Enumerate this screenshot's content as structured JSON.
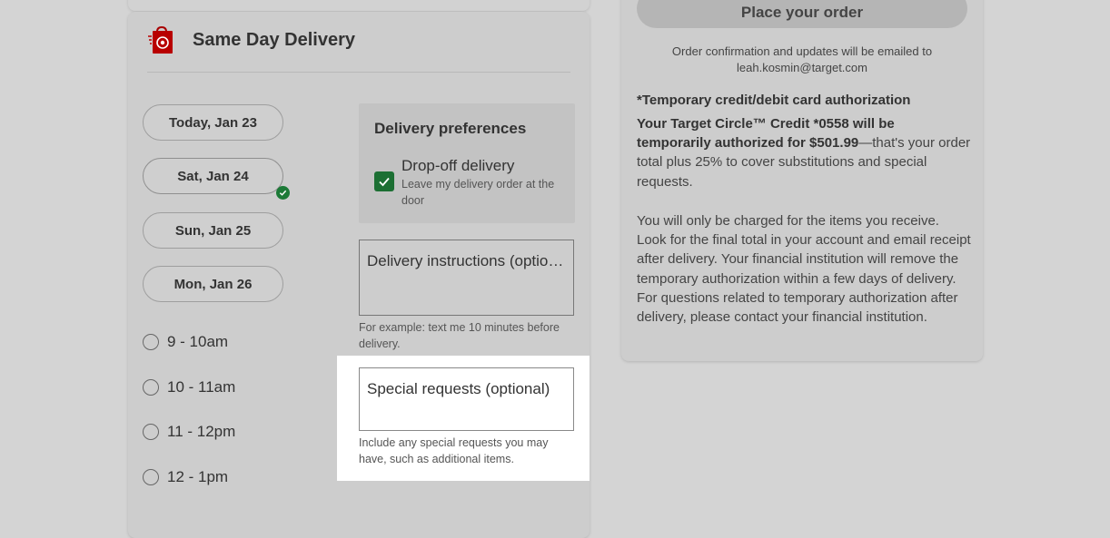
{
  "delivery": {
    "title": "Same Day Delivery",
    "days": [
      {
        "label": "Today, Jan 23",
        "selected": false
      },
      {
        "label": "Sat, Jan 24",
        "selected": true
      },
      {
        "label": "Sun, Jan 25",
        "selected": false
      },
      {
        "label": "Mon, Jan 26",
        "selected": false
      }
    ],
    "time_slots": [
      "9 - 10am",
      "10 - 11am",
      "11 - 12pm",
      "12 - 1pm"
    ]
  },
  "preferences": {
    "title": "Delivery preferences",
    "dropoff_label": "Drop-off delivery",
    "dropoff_sub": "Leave my delivery order at the door",
    "dropoff_checked": true
  },
  "instructions": {
    "label": "Delivery instructions (optional)",
    "helper": "For example: text me 10 minutes before delivery."
  },
  "special_requests": {
    "label": "Special requests (optional)",
    "helper": "Include any special requests you may have, such as additional items."
  },
  "order": {
    "place_button": "Place your order",
    "confirmation": "Order confirmation and updates will be emailed to leah.kosmin@target.com",
    "auth_title": "*Temporary credit/debit card authorization",
    "auth_bold": "Your Target Circle™ Credit *0558 will be temporarily authorized for $501.99",
    "auth_rest": "—that's your order total plus 25% to cover substitutions and special requests.",
    "auth_body2": "You will only be charged for the items you receive. Look for the final total in your account and email receipt after delivery. Your financial institution will remove the temporary authorization within a few days of delivery. For questions related to temporary authorization after delivery, please contact your financial institution."
  },
  "colors": {
    "brand_red": "#cc0000",
    "check_green": "#1c7a37"
  }
}
